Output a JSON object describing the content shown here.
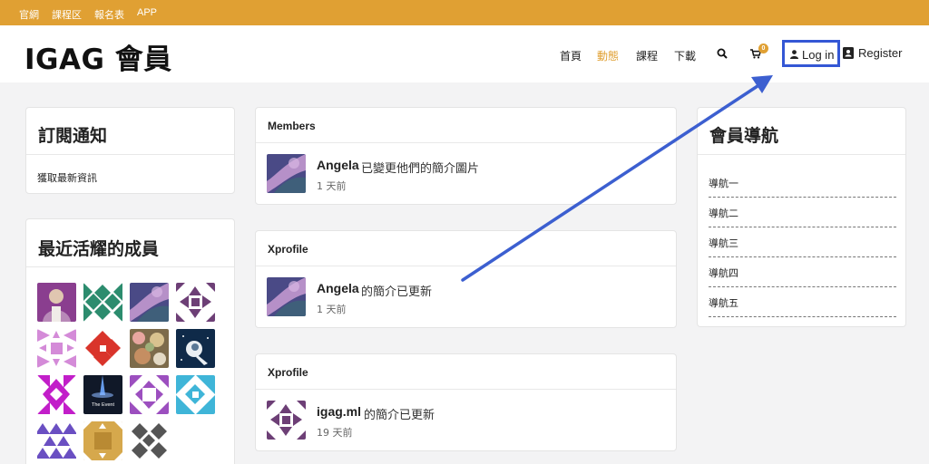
{
  "topbar": {
    "links": [
      "官網",
      "課程区",
      "報名表",
      "APP"
    ]
  },
  "header": {
    "site_title": "IGAG 會員",
    "nav": [
      {
        "label": "首頁",
        "active": false
      },
      {
        "label": "動態",
        "active": true
      },
      {
        "label": "課程",
        "active": false
      },
      {
        "label": "下載",
        "active": false
      }
    ],
    "cart_count": "0",
    "login_label": "Log in",
    "register_label": "Register",
    "icons": [
      "search-icon",
      "cart-icon",
      "user-icon",
      "address-card-icon"
    ]
  },
  "subscribe": {
    "title": "訂閱通知",
    "link": "獲取最新資訊"
  },
  "members_widget": {
    "title": "最近活耀的成員",
    "event_tile_text": "The Event"
  },
  "activity": [
    {
      "heading": "Members",
      "name": "Angela",
      "text": "已變更他們的簡介圖片",
      "time": "1 天前"
    },
    {
      "heading": "Xprofile",
      "name": "Angela",
      "text": "的簡介已更新",
      "time": "1 天前"
    },
    {
      "heading": "Xprofile",
      "name": "igag.ml",
      "text": "的簡介已更新",
      "time": "19 天前"
    }
  ],
  "member_nav": {
    "title": "會員導航",
    "items": [
      "導航一",
      "導航二",
      "導航三",
      "導航四",
      "導航五"
    ]
  },
  "colors": {
    "accent": "#e0a033",
    "highlight": "#3457d5"
  }
}
